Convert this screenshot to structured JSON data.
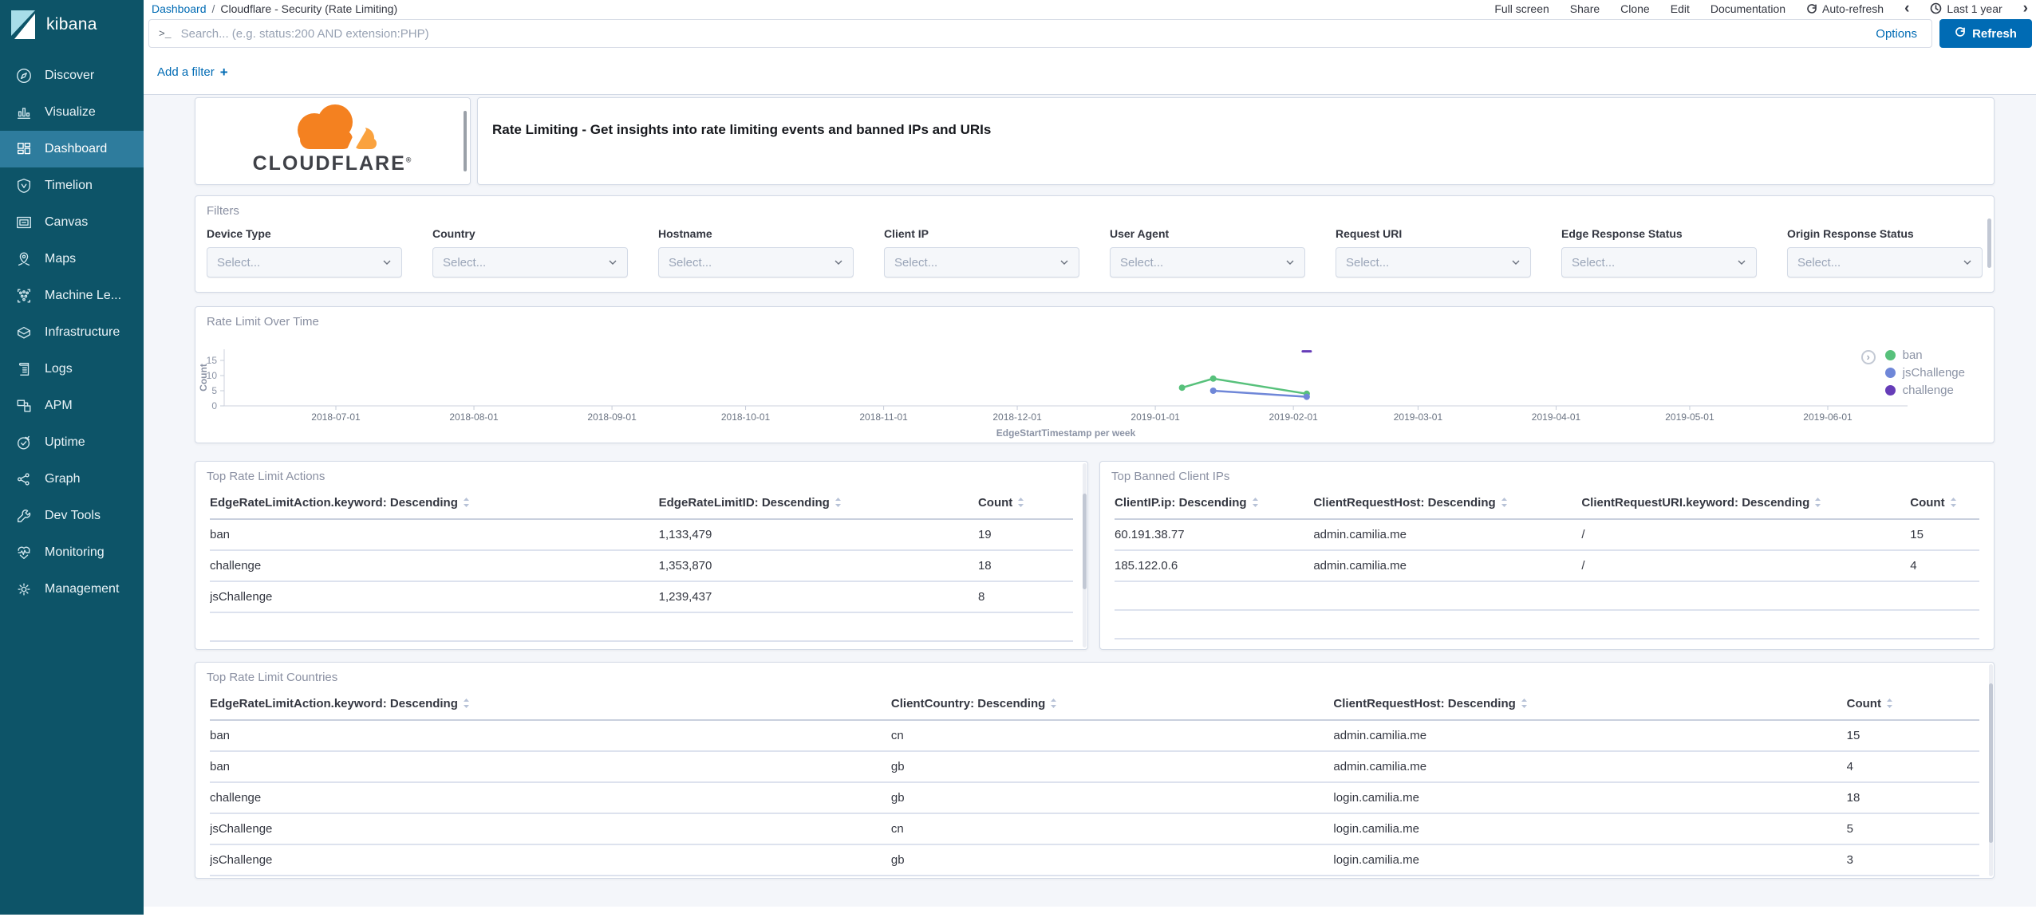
{
  "sidebar": {
    "logo": "kibana",
    "items": [
      {
        "id": "discover",
        "label": "Discover",
        "active": false
      },
      {
        "id": "visualize",
        "label": "Visualize",
        "active": false
      },
      {
        "id": "dashboard",
        "label": "Dashboard",
        "active": true
      },
      {
        "id": "timelion",
        "label": "Timelion",
        "active": false
      },
      {
        "id": "canvas",
        "label": "Canvas",
        "active": false
      },
      {
        "id": "maps",
        "label": "Maps",
        "active": false
      },
      {
        "id": "machine-learning",
        "label": "Machine Le...",
        "active": false
      },
      {
        "id": "infrastructure",
        "label": "Infrastructure",
        "active": false
      },
      {
        "id": "logs",
        "label": "Logs",
        "active": false
      },
      {
        "id": "apm",
        "label": "APM",
        "active": false
      },
      {
        "id": "uptime",
        "label": "Uptime",
        "active": false
      },
      {
        "id": "graph",
        "label": "Graph",
        "active": false
      },
      {
        "id": "dev-tools",
        "label": "Dev Tools",
        "active": false
      },
      {
        "id": "monitoring",
        "label": "Monitoring",
        "active": false
      },
      {
        "id": "management",
        "label": "Management",
        "active": false
      }
    ]
  },
  "topbar": {
    "breadcrumb": {
      "link": "Dashboard",
      "separator": "/",
      "current": "Cloudflare - Security (Rate Limiting)"
    },
    "actions": [
      "Full screen",
      "Share",
      "Clone",
      "Edit",
      "Documentation"
    ],
    "auto_refresh_label": "Auto-refresh",
    "time_range_label": "Last 1 year",
    "prev_arrow": "‹",
    "next_arrow": "›"
  },
  "querybar": {
    "prompt_glyph": ">_",
    "placeholder": "Search... (e.g. status:200 AND extension:PHP)",
    "options_label": "Options",
    "refresh_label": "Refresh"
  },
  "filter_bar": {
    "add_filter_label": "Add a filter",
    "plus_glyph": "+"
  },
  "panels": {
    "logo_panel": {
      "brand": "CLOUDFLARE",
      "registered_mark": "®"
    },
    "description_panel": {
      "title": "Rate Limiting - Get insights into rate limiting events and banned IPs and URIs"
    },
    "filters_panel": {
      "title": "Filters",
      "select_placeholder": "Select...",
      "fields": [
        "Device Type",
        "Country",
        "Hostname",
        "Client IP",
        "User Agent",
        "Request URI",
        "Edge Response Status",
        "Origin Response Status"
      ]
    },
    "chart_panel": {
      "title": "Rate Limit Over Time"
    },
    "actions_table": {
      "title": "Top Rate Limit Actions",
      "columns": [
        "EdgeRateLimitAction.keyword: Descending",
        "EdgeRateLimitID: Descending",
        "Count"
      ],
      "rows": [
        [
          "ban",
          "1,133,479",
          "19"
        ],
        [
          "challenge",
          "1,353,870",
          "18"
        ],
        [
          "jsChallenge",
          "1,239,437",
          "8"
        ]
      ]
    },
    "banned_ips_table": {
      "title": "Top Banned Client IPs",
      "columns": [
        "ClientIP.ip: Descending",
        "ClientRequestHost: Descending",
        "ClientRequestURI.keyword: Descending",
        "Count"
      ],
      "rows": [
        [
          "60.191.38.77",
          "admin.camilia.me",
          "/",
          "15"
        ],
        [
          "185.122.0.6",
          "admin.camilia.me",
          "/",
          "4"
        ]
      ]
    },
    "countries_table": {
      "title": "Top Rate Limit Countries",
      "columns": [
        "EdgeRateLimitAction.keyword: Descending",
        "ClientCountry: Descending",
        "ClientRequestHost: Descending",
        "Count"
      ],
      "rows": [
        [
          "ban",
          "cn",
          "admin.camilia.me",
          "15"
        ],
        [
          "ban",
          "gb",
          "admin.camilia.me",
          "4"
        ],
        [
          "challenge",
          "gb",
          "login.camilia.me",
          "18"
        ],
        [
          "jsChallenge",
          "cn",
          "login.camilia.me",
          "5"
        ],
        [
          "jsChallenge",
          "gb",
          "login.camilia.me",
          "3"
        ]
      ]
    }
  },
  "chart_data": {
    "type": "line",
    "title": "Rate Limit Over Time",
    "xlabel": "EdgeStartTimestamp per week",
    "ylabel": "Count",
    "x_domain": [
      "2018-06-06",
      "2019-06-19"
    ],
    "xticks": [
      "2018-07-01",
      "2018-08-01",
      "2018-09-01",
      "2018-10-01",
      "2018-11-01",
      "2018-12-01",
      "2019-01-01",
      "2019-02-01",
      "2019-03-01",
      "2019-04-01",
      "2019-05-01",
      "2019-06-01"
    ],
    "yticks": [
      0,
      5,
      10,
      15
    ],
    "ylim": [
      0,
      18.5
    ],
    "grid": false,
    "legend_position": "right",
    "series": [
      {
        "name": "ban",
        "color": "#57c17b",
        "points": [
          {
            "x": "2019-01-07",
            "y": 6
          },
          {
            "x": "2019-01-14",
            "y": 9
          },
          {
            "x": "2019-02-04",
            "y": 4
          }
        ]
      },
      {
        "name": "jsChallenge",
        "color": "#6f87d8",
        "points": [
          {
            "x": "2019-01-14",
            "y": 5
          },
          {
            "x": "2019-02-04",
            "y": 3
          }
        ]
      },
      {
        "name": "challenge",
        "color": "#663db8",
        "points": [
          {
            "x": "2019-02-04",
            "y": 18
          }
        ]
      }
    ]
  },
  "colors": {
    "accent_blue": "#006bb4",
    "sidebar_bg": "#0d5468",
    "sidebar_active_bg": "#2e7c9d",
    "content_bg": "#f4f6fa",
    "panel_border": "#d3dae6",
    "series_ban": "#57c17b",
    "series_jschallenge": "#6f87d8",
    "series_challenge": "#663db8",
    "cloudflare_orange": "#f48120",
    "cloudflare_light_orange": "#faa23e"
  }
}
